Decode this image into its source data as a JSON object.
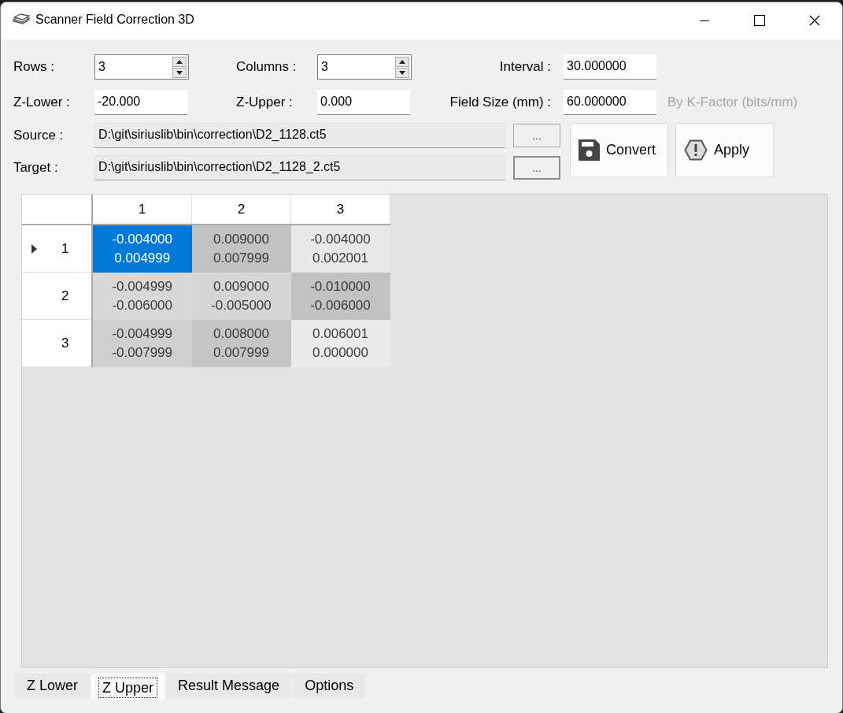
{
  "window": {
    "title": "Scanner Field Correction 3D"
  },
  "rows": {
    "label": "Rows :",
    "value": "3"
  },
  "columns": {
    "label": "Columns :",
    "value": "3"
  },
  "interval": {
    "label": "Interval :",
    "value": "30.000000"
  },
  "z_lower": {
    "label": "Z-Lower :",
    "value": "-20.000"
  },
  "z_upper": {
    "label": "Z-Upper :",
    "value": "0.000"
  },
  "field_size": {
    "label": "Field Size (mm) :",
    "value": "60.000000"
  },
  "k_factor": {
    "label": "By K-Factor (bits/mm)",
    "disabled": true
  },
  "source": {
    "label": "Source :",
    "value": "D:\\git\\siriuslib\\bin\\correction\\D2_1128.ct5",
    "browse": "...",
    "focused": false
  },
  "target": {
    "label": "Target :",
    "value": "D:\\git\\siriuslib\\bin\\correction\\D2_1128_2.ct5",
    "browse": "...",
    "focused": true
  },
  "actions": [
    {
      "label": "Convert",
      "kind": "save"
    },
    {
      "label": "Apply",
      "kind": "warning"
    }
  ],
  "table": {
    "columns": [
      "1",
      "2",
      "3"
    ],
    "rows": [
      {
        "header": "1",
        "current": true,
        "cells": [
          {
            "text": "-0.004000\n0.004999",
            "selected": true
          },
          {
            "text": "0.009000\n0.007999",
            "selected": false,
            "color": "#c2c2c2"
          },
          {
            "text": "-0.004000\n0.002001",
            "selected": false,
            "color": "#e8e8e8"
          }
        ]
      },
      {
        "header": "2",
        "current": false,
        "cells": [
          {
            "text": "-0.004999\n-0.006000",
            "selected": false,
            "color": "#d8d8d8"
          },
          {
            "text": "0.009000\n-0.005000",
            "selected": false,
            "color": "#d6d6d6"
          },
          {
            "text": "-0.010000\n-0.006000",
            "selected": false,
            "color": "#c2c2c2"
          }
        ]
      },
      {
        "header": "3",
        "current": false,
        "cells": [
          {
            "text": "-0.004999\n-0.007999",
            "selected": false,
            "color": "#cfcfcf"
          },
          {
            "text": "0.008000\n0.007999",
            "selected": false,
            "color": "#c6c6c6"
          },
          {
            "text": "0.006001\n0.000000",
            "selected": false,
            "color": "#ebebeb"
          }
        ]
      }
    ]
  },
  "tabs": [
    {
      "label": "Z Lower",
      "selected": false
    },
    {
      "label": "Z Upper",
      "selected": true
    },
    {
      "label": "Result Message",
      "selected": false
    },
    {
      "label": "Options",
      "selected": false
    }
  ]
}
